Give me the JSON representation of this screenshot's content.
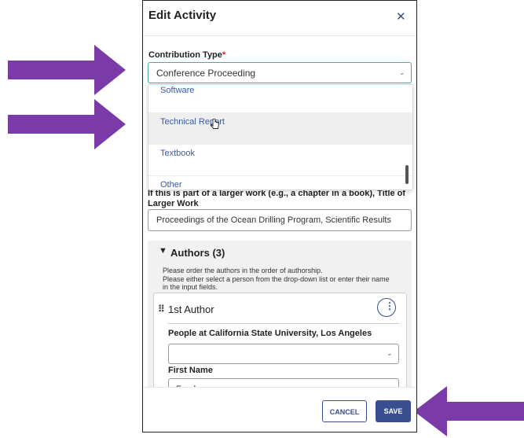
{
  "modal": {
    "title": "Edit Activity",
    "close_icon": "close-icon"
  },
  "contribution_type": {
    "label": "Contribution Type",
    "required_mark": "*",
    "value": "Conference Proceeding",
    "options": [
      "Software",
      "Technical Report",
      "Textbook",
      "Other"
    ],
    "hovered_option": "Technical Report"
  },
  "larger_work": {
    "label": "If this is part of a larger work (e.g., a chapter in a book), Title of Larger Work",
    "value": "Proceedings of the Ocean Drilling Program, Scientific Results"
  },
  "authors": {
    "title": "Authors (3)",
    "instruction_1": "Please order the authors in the order of authorship.",
    "instruction_2": "Please either select a person from the drop-down list or enter their name",
    "instruction_3": "in the input fields.",
    "card": {
      "heading": "1st Author",
      "people_label": "People at California State University, Los Angeles",
      "people_value": "",
      "first_name_label": "First Name",
      "first_name_value": "Frank"
    }
  },
  "footer": {
    "cancel_label": "CANCEL",
    "save_label": "SAVE"
  },
  "colors": {
    "accent": "#3a4f8f",
    "arrow": "#7a3aa8",
    "focus": "#4aa8a6"
  }
}
